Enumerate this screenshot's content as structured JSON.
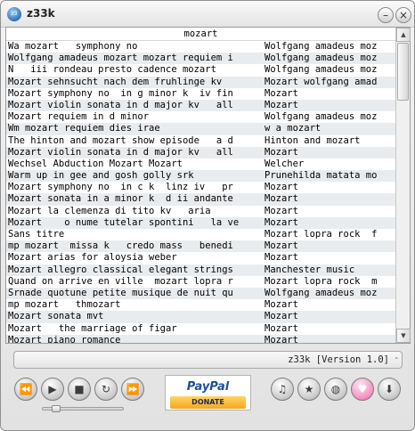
{
  "window": {
    "title": "z33k"
  },
  "list": {
    "header": "mozart",
    "rows": [
      {
        "title": "Wa mozart   symphony no",
        "artist": "Wolfgang amadeus moz"
      },
      {
        "title": "Wolfgang amadeus mozart mozart requiem i",
        "artist": "Wolfgang amadeus moz"
      },
      {
        "title": "N   iii rondeau presto cadence mozart",
        "artist": "Wolfgang amadeus moz"
      },
      {
        "title": "Mozart sehnsucht nach dem fruhlinge kv",
        "artist": "Mozart wolfgang amad"
      },
      {
        "title": "Mozart symphony no  in g minor k  iv fin",
        "artist": "Mozart"
      },
      {
        "title": "Mozart violin sonata in d major kv   all",
        "artist": "Mozart"
      },
      {
        "title": "Mozart requiem in d minor",
        "artist": "Wolfgang amadeus moz"
      },
      {
        "title": "Wm mozart requiem dies irae",
        "artist": "w a mozart"
      },
      {
        "title": "The hinton and mozart show episode   a d",
        "artist": "Hinton and mozart"
      },
      {
        "title": "Mozart violin sonata in d major kv   all",
        "artist": "Mozart"
      },
      {
        "title": "Wechsel Abduction Mozart Mozart",
        "artist": "Welcher"
      },
      {
        "title": "Warm up in gee and gosh golly srk",
        "artist": "Prunehilda matata mo"
      },
      {
        "title": "Mozart symphony no  in c k  linz iv   pr",
        "artist": "Mozart"
      },
      {
        "title": "Mozart sonata in a minor k  d ii andante",
        "artist": "Mozart"
      },
      {
        "title": "Mozart la clemenza di tito kv   aria",
        "artist": "Mozart"
      },
      {
        "title": "Mozart    o nume tutelar spontini   la ve",
        "artist": "Mozart"
      },
      {
        "title": "Sans titre",
        "artist": "Mozart lopra rock  f"
      },
      {
        "title": "mp mozart  missa k   credo mass   benedi",
        "artist": "Mozart"
      },
      {
        "title": "Mozart arias for aloysia weber",
        "artist": "Mozart"
      },
      {
        "title": "Mozart allegro classical elegant strings",
        "artist": "Manchester music"
      },
      {
        "title": "Quand on arrive en ville  mozart lopra r",
        "artist": "Mozart lopra rock  m"
      },
      {
        "title": "Srnade quotune petite musique de nuit qu",
        "artist": "Wolfgang amadeus moz"
      },
      {
        "title": "mp mozart   thmozart",
        "artist": "Mozart"
      },
      {
        "title": "Mozart sonata mvt",
        "artist": "Mozart"
      },
      {
        "title": "Mozart   the marriage of figar",
        "artist": "Mozart"
      },
      {
        "title": "Mozart piano romance",
        "artist": "Mozart"
      }
    ]
  },
  "scrollbar": {
    "up_glyph": "▲",
    "down_glyph": "▼"
  },
  "status": {
    "text": "z33k [Version 1.0]",
    "dash": "-"
  },
  "controls": {
    "rewind": "⏪",
    "play": "▶",
    "stop": "■",
    "repeat": "↻",
    "forward": "⏩",
    "music": "♫",
    "star": "★",
    "globe": "◍",
    "heart": "♥",
    "download": "⬇"
  },
  "donate": {
    "logo": "PayPal",
    "label": "DONATE"
  },
  "titlebar": {
    "min_glyph": "–",
    "close_glyph": "×",
    "icon_text": "z3"
  }
}
